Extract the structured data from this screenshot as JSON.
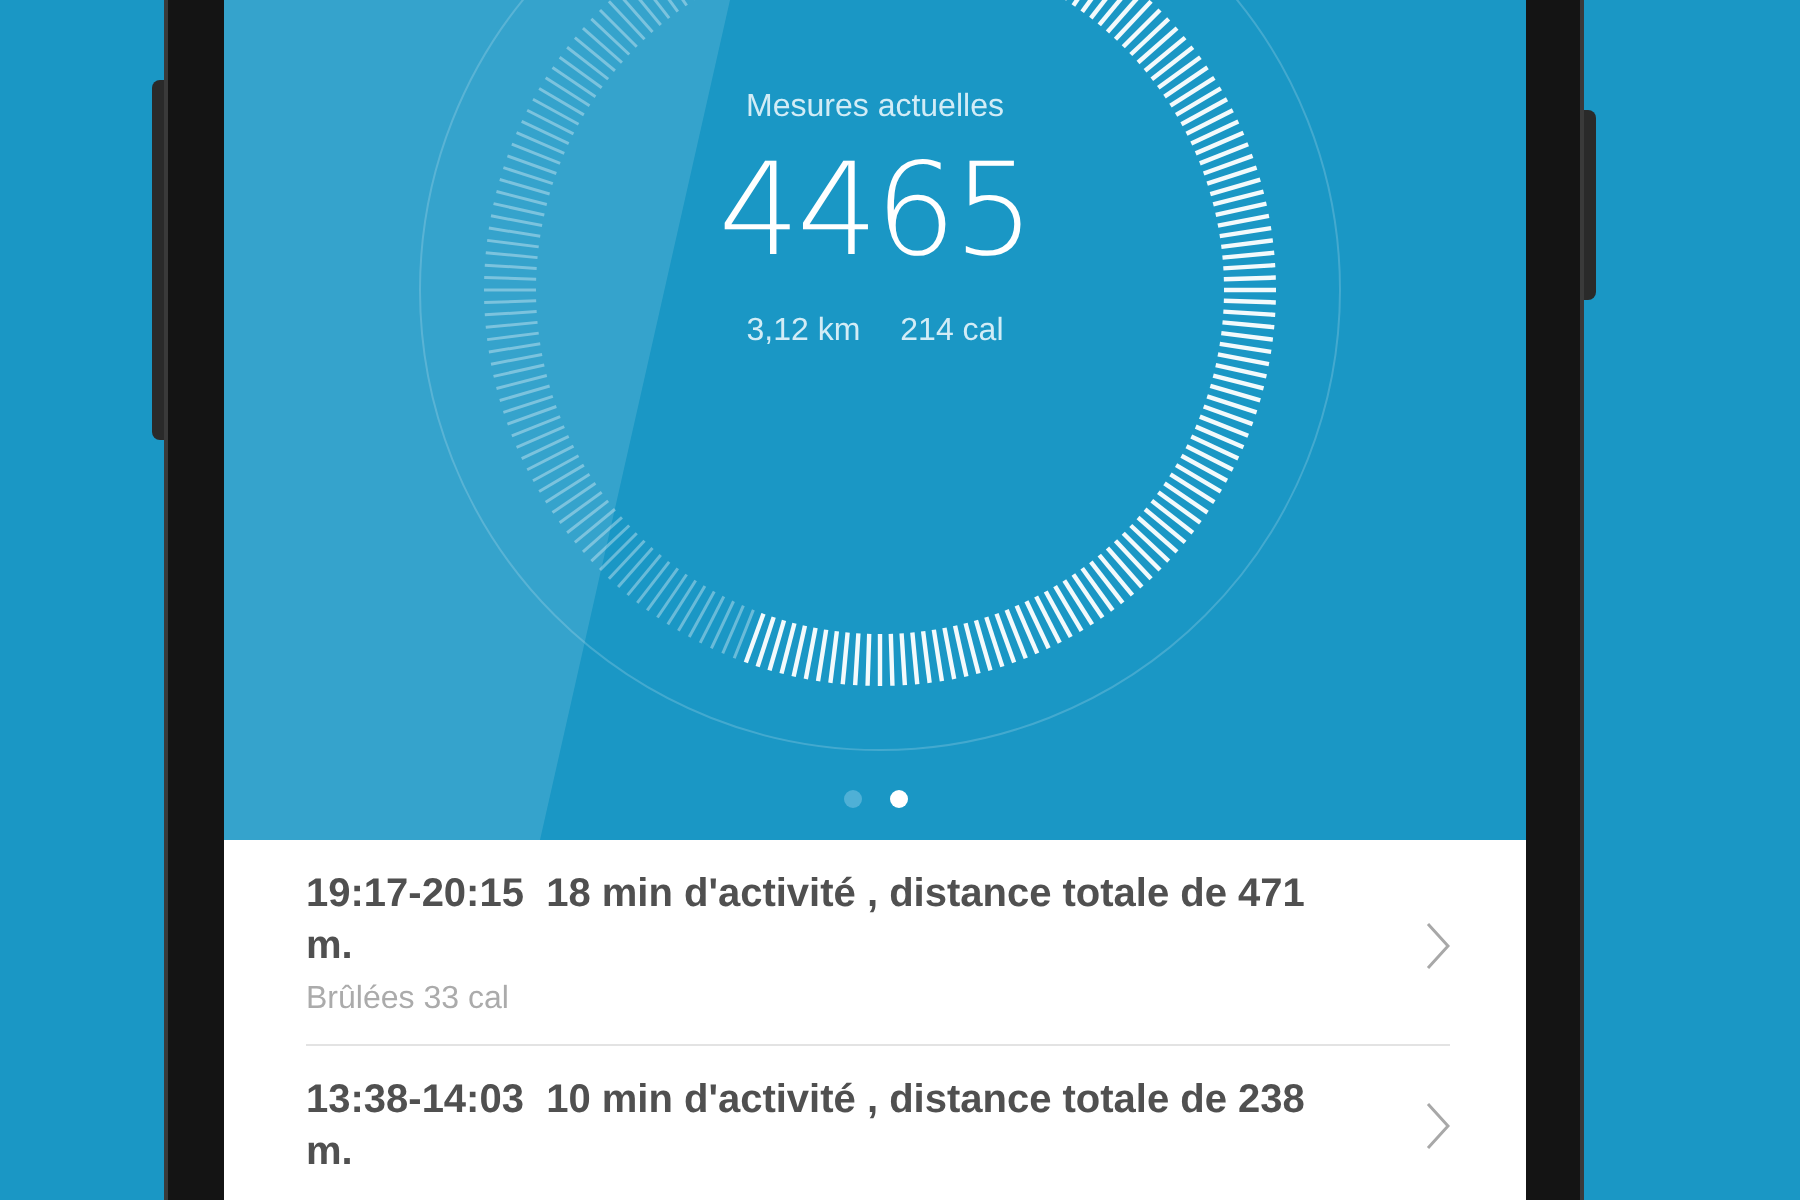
{
  "summary": {
    "label": "Mesures actuelles",
    "steps": "4465",
    "distance": "3,12 km",
    "calories": "214 cal"
  },
  "pager": [
    {
      "selected": false
    },
    {
      "selected": true
    }
  ],
  "activities": [
    {
      "title": "19:17-20:15  18 min d'activité , distance totale de 471 m.",
      "detail": "Brûlées 33 cal"
    },
    {
      "title": "13:38-14:03  10 min d'activité , distance totale de 238 m."
    }
  ]
}
